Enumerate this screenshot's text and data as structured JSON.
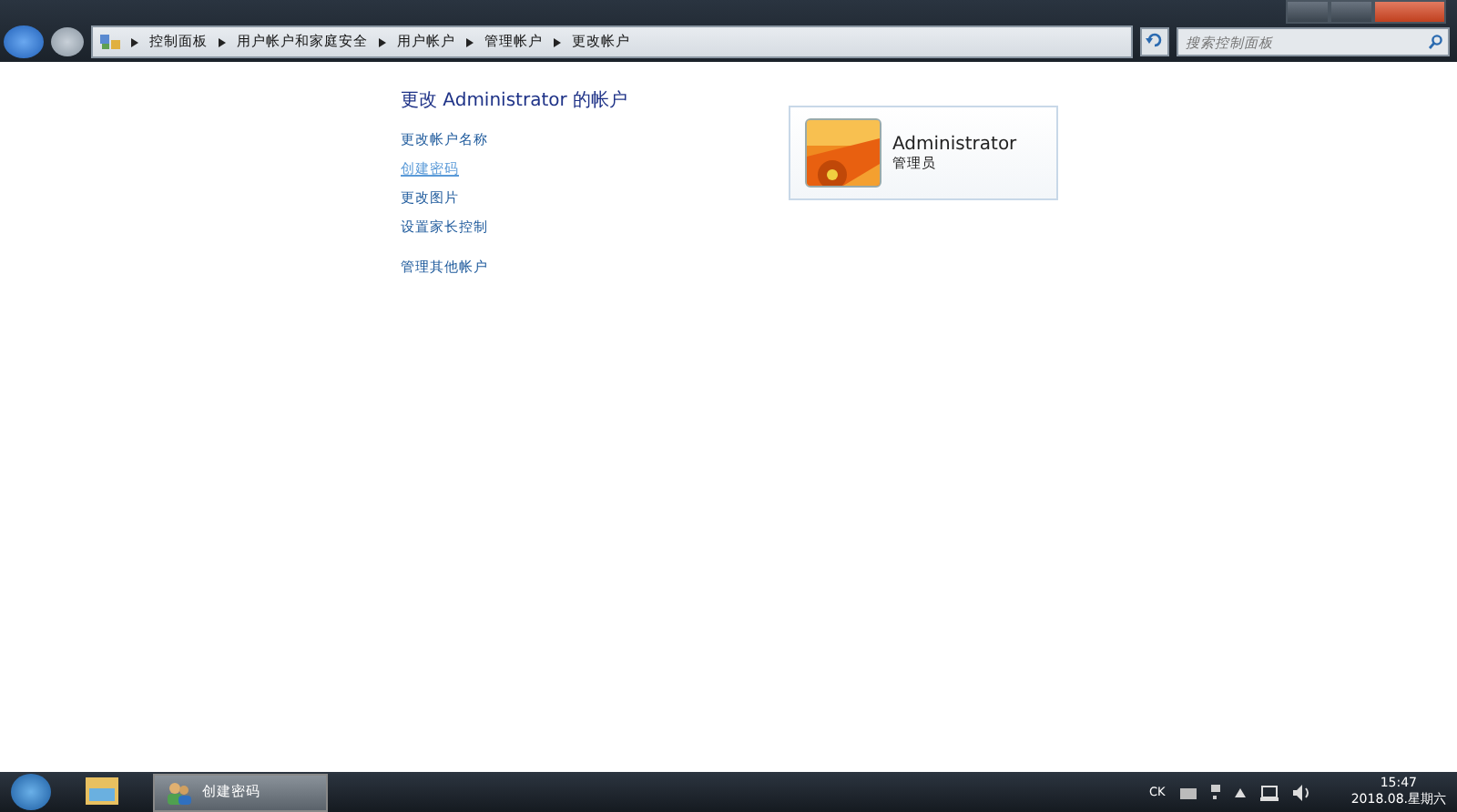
{
  "address_bar": {
    "breadcrumbs": [
      "控制面板",
      "用户帐户和家庭安全",
      "用户帐户",
      "管理帐户",
      "更改帐户"
    ]
  },
  "search": {
    "placeholder": "搜索控制面板"
  },
  "heading": "更改 Administrator 的帐户",
  "tasks": [
    {
      "label": "更改帐户名称",
      "hovered": false
    },
    {
      "label": "创建密码",
      "hovered": true
    },
    {
      "label": "更改图片",
      "hovered": false
    },
    {
      "label": "设置家长控制",
      "hovered": false
    },
    {
      "label": "管理其他帐户",
      "hovered": false
    }
  ],
  "account": {
    "name": "Administrator",
    "role": "管理员"
  },
  "taskbar": {
    "window_button": "创建密码",
    "tray": {
      "language": "CK",
      "time": "15:47",
      "date": "2018.08.星期六"
    }
  }
}
